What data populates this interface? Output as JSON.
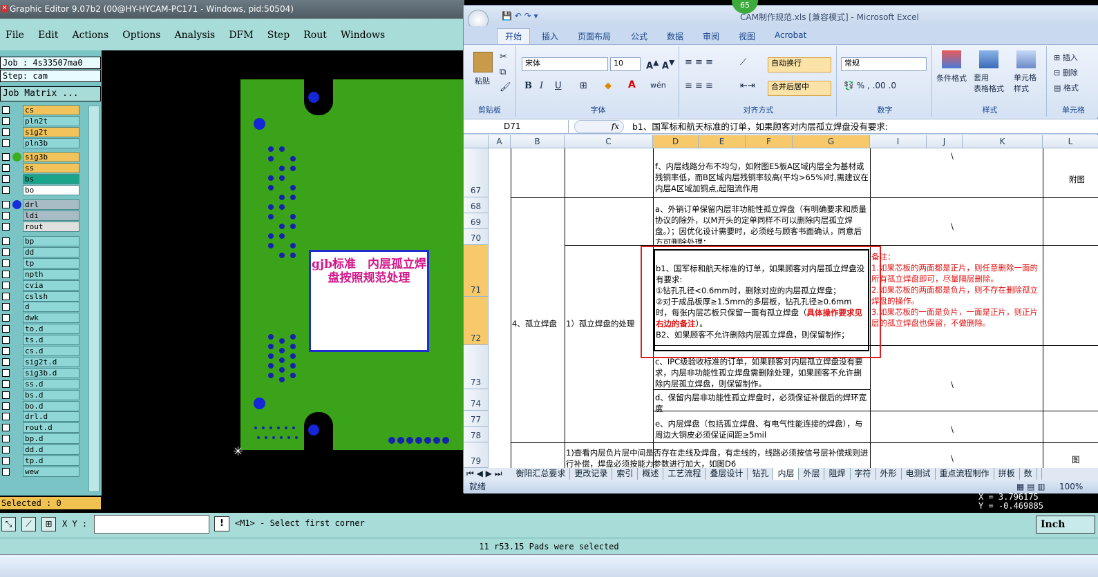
{
  "genesis": {
    "title": "Graphic Editor 9.07b2 (00@HY-HYCAM-PC171 - Windows, pid:50504)",
    "menu": [
      "File",
      "Edit",
      "Actions",
      "Options",
      "Analysis",
      "DFM",
      "Step",
      "Rout",
      "Windows"
    ],
    "job": "Job : 4s33507ma0",
    "step": "Step: cam",
    "job_matrix": "Job Matrix ...",
    "layers": [
      {
        "name": "cs",
        "color": "#f2c35a",
        "dot": ""
      },
      {
        "name": "pln2t",
        "color": "#8fd7d7",
        "dot": ""
      },
      {
        "name": "sig2t",
        "color": "#f2c35a",
        "dot": ""
      },
      {
        "name": "pln3b",
        "color": "#8fd7d7",
        "dot": ""
      },
      {
        "name": "sig3b",
        "color": "#f2c35a",
        "dot": "#3cae1c"
      },
      {
        "name": "ss",
        "color": "#f2c35a",
        "dot": ""
      },
      {
        "name": "bs",
        "color": "#1aa58a",
        "dot": ""
      },
      {
        "name": "bo",
        "color": "#ffffff",
        "dot": ""
      },
      {
        "name": "drl",
        "color": "#a8bcc6",
        "dot": "#1a2ed8"
      },
      {
        "name": "ldi",
        "color": "#a8bcc6",
        "dot": ""
      },
      {
        "name": "rout",
        "color": "#e0e0e0",
        "dot": ""
      },
      {
        "name": "bp",
        "color": "#8fd7d7",
        "dot": ""
      },
      {
        "name": "dd",
        "color": "#8fd7d7",
        "dot": ""
      },
      {
        "name": "tp",
        "color": "#8fd7d7",
        "dot": ""
      },
      {
        "name": "npth",
        "color": "#8fd7d7",
        "dot": ""
      },
      {
        "name": "cvia",
        "color": "#8fd7d7",
        "dot": ""
      },
      {
        "name": "cslsh",
        "color": "#8fd7d7",
        "dot": ""
      },
      {
        "name": "d",
        "color": "#8fd7d7",
        "dot": ""
      },
      {
        "name": "dwk",
        "color": "#8fd7d7",
        "dot": ""
      },
      {
        "name": "to.d",
        "color": "#8fd7d7",
        "dot": ""
      },
      {
        "name": "ts.d",
        "color": "#8fd7d7",
        "dot": ""
      },
      {
        "name": "cs.d",
        "color": "#8fd7d7",
        "dot": ""
      },
      {
        "name": "sig2t.d",
        "color": "#8fd7d7",
        "dot": ""
      },
      {
        "name": "sig3b.d",
        "color": "#8fd7d7",
        "dot": ""
      },
      {
        "name": "ss.d",
        "color": "#8fd7d7",
        "dot": ""
      },
      {
        "name": "bs.d",
        "color": "#8fd7d7",
        "dot": ""
      },
      {
        "name": "bo.d",
        "color": "#8fd7d7",
        "dot": ""
      },
      {
        "name": "drl.d",
        "color": "#8fd7d7",
        "dot": ""
      },
      {
        "name": "rout.d",
        "color": "#8fd7d7",
        "dot": ""
      },
      {
        "name": "bp.d",
        "color": "#8fd7d7",
        "dot": ""
      },
      {
        "name": "dd.d",
        "color": "#8fd7d7",
        "dot": ""
      },
      {
        "name": "tp.d",
        "color": "#8fd7d7",
        "dot": ""
      },
      {
        "name": "wew",
        "color": "#8fd7d7",
        "dot": ""
      }
    ],
    "selected": "Selected : 0",
    "pcb_note": "gjb标准　内层孤立焊盘按照规范处理",
    "xy_label": "X Y :",
    "prompt": "<M1> - Select first corner",
    "unit": "Inch",
    "status": "11 r53.15 Pads were selected",
    "coord_x": "X = 3.796175",
    "coord_y": "Y = -0.469885"
  },
  "excel": {
    "badge": "65",
    "title": "CAM制作规范.xls  [兼容模式] - Microsoft Excel",
    "tabs": [
      "开始",
      "插入",
      "页面布局",
      "公式",
      "数据",
      "审阅",
      "视图",
      "Acrobat"
    ],
    "clipboard": {
      "paste": "粘贴",
      "label": "剪贴板"
    },
    "font": {
      "name": "宋体",
      "size": "10",
      "label": "字体"
    },
    "align": {
      "wrap": "自动换行",
      "merge": "合并后居中",
      "label": "对齐方式"
    },
    "number": {
      "format": "常规",
      "label": "数字"
    },
    "styles": {
      "cond": "条件格式",
      "table": "套用\n表格格式",
      "cell": "单元格\n样式",
      "label": "样式"
    },
    "cells": {
      "insert": "插入",
      "delete": "删除",
      "format": "格式",
      "label": "单元格"
    },
    "name_box": "D71",
    "fx": "fx",
    "formula": "b1、国军标和航天标准的订单，如果顾客对内层孤立焊盘没有要求:",
    "columns": [
      "A",
      "B",
      "C",
      "D",
      "E",
      "F",
      "G",
      "I",
      "J",
      "K",
      "L"
    ],
    "rows": [
      "67",
      "68",
      "69",
      "70",
      "71",
      "72",
      "73",
      "74",
      "77",
      "78",
      "79"
    ],
    "b_cell": "4、孤立焊盘",
    "c_cell": "1）孤立焊盘的处理",
    "d67": "f、内层线路分布不均匀，如附图E5板A区域内层全为基材或残铜率低，而B区域内层残铜率较高(平均>65%)时,需建议在内层A区域加铜点,起阻流作用",
    "d68": "a、外销订单保留内层非功能性孤立焊盘（有明确要求和质量协议的除外，以M开头的定单同样不可以删除内层孤立焊盘。）；因优化设计需要时，必须经与顾客书面确认，同意后方可删除处理；",
    "d71a": "b1、国军标和航天标准的订单，如果顾客对内层孤立焊盘没有要求:",
    "d71b": "①钻孔孔径<0.6mm时，删除对应的内层孤立焊盘；",
    "d71c": "②对于成品板厚≥1.5mm的多层板，钻孔孔径≥0.6mm时，每张内层芯板只保留一面有孤立焊盘（",
    "d71red": "具体操作要求见右边的备注",
    "d71d": "）。",
    "d71e": "B2、如果顾客不允许删除内层孤立焊盘，则保留制作；",
    "note_title": "备注：",
    "note1": "1.如果芯板的两面都是正片，则任意删除一面的所有孤立焊盘即可，尽量隔层删除。",
    "note2": "2.如果芯板的两面都是负片，则不存在删除孤立焊盘的操作。",
    "note3": "3.如果芯板的一面是负片，一面是正片，则正片层的孤立焊盘也保留，不做删除。",
    "d73": "c、IPC级验收标准的订单，如果顾客对内层孤立焊盘没有要求，内层非功能性孤立焊盘需删除处理，如果顾客不允许删除内层孤立焊盘，则保留制作。",
    "d74": "d、保留内层非功能性孤立焊盘时，必须保证补偿后的焊环宽度",
    "d77": "e、内层焊盘（包括孤立焊盘、有电气性能连接的焊盘），与周边大铜皮必须保证间距≥5mil",
    "c79": "1)查看内层负片层中间是否存在走线及焊盘，有走线的，线路必须按信号层补偿规则进行补偿，焊盘必须按能力参数进行加大，如图D6",
    "slash": "\\",
    "k67": "附图",
    "k79": "图",
    "sheets": [
      "衡阳汇总要求",
      "更改记录",
      "索引",
      "概述",
      "工艺流程",
      "叠层设计",
      "钻孔",
      "内层",
      "外层",
      "阻焊",
      "字符",
      "外形",
      "电测试",
      "重点流程制作",
      "拼板",
      "数"
    ],
    "status": "就绪",
    "zoom": "100%"
  }
}
